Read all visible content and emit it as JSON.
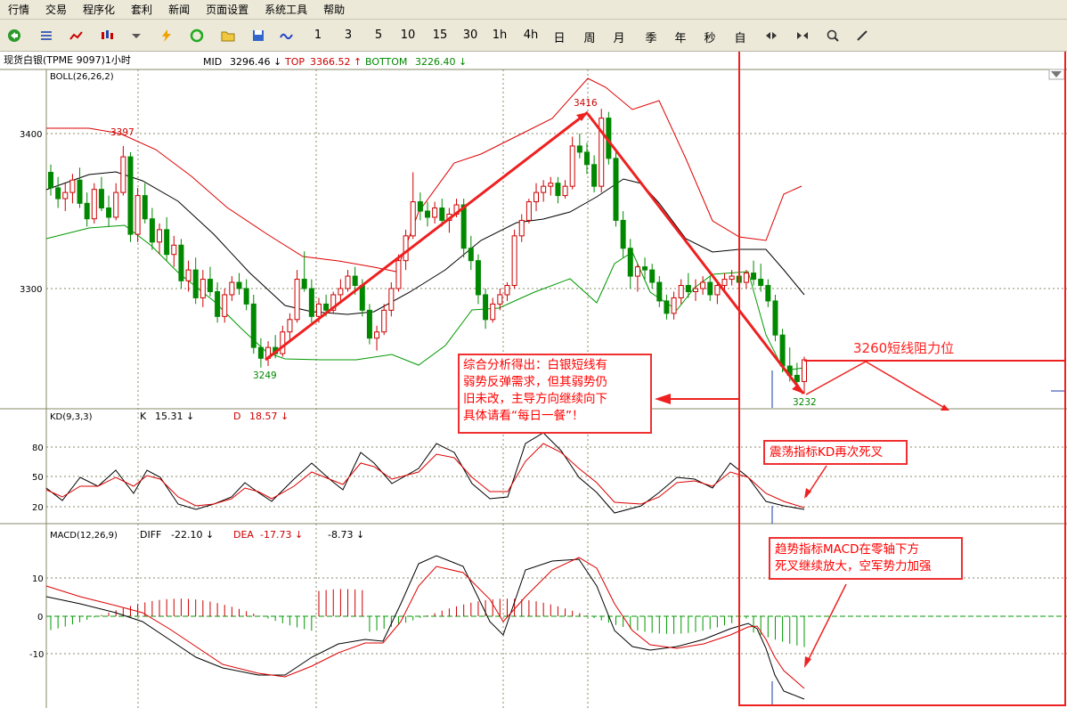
{
  "menu": [
    "行情",
    "交易",
    "程序化",
    "套利",
    "新闻",
    "页面设置",
    "系统工具",
    "帮助"
  ],
  "toolbar": {
    "icons": [
      "back-arrow-icon",
      "list-icon",
      "line-chart-icon",
      "candlestick-icon",
      "dropdown-arrow-icon",
      "lightning-icon",
      "refresh-icon",
      "open-folder-icon",
      "save-icon",
      "wave-icon"
    ],
    "periods": [
      "1",
      "3",
      "5",
      "10",
      "15",
      "30",
      "1h",
      "4h",
      "日",
      "周",
      "月",
      "季",
      "年",
      "秒",
      "自"
    ],
    "tool_icons": [
      "zoom-in-icon",
      "zoom-out-icon",
      "search-icon",
      "pen-icon"
    ]
  },
  "header": {
    "instrument": "现货白银(TPME 9097)1小时",
    "mid_label": "MID",
    "mid_value": "3296.46 ↓",
    "top_label": "TOP",
    "top_value": "3366.52 ↑",
    "bottom_label": "BOTTOM",
    "bottom_value": "3226.40 ↓"
  },
  "panels": {
    "boll": {
      "title": "BOLL(26,26,2)",
      "yticks": [
        "3400",
        "3300"
      ]
    },
    "kd": {
      "title": "KD(9,3,3)",
      "k_label": "K",
      "k_value": "15.31 ↓",
      "d_label": "D",
      "d_value": "18.57 ↓",
      "yticks": [
        "80",
        "50",
        "20"
      ]
    },
    "macd": {
      "title": "MACD(12,26,9)",
      "diff_label": "DIFF",
      "diff_value": "-22.10 ↓",
      "dea_label": "DEA",
      "dea_value": "-17.73 ↓",
      "macd_value": "-8.73 ↓",
      "yticks": [
        "10",
        "0",
        "-10"
      ]
    }
  },
  "price_labels": {
    "high1": "3397",
    "high2": "3416",
    "low1": "3249",
    "low2": "3232"
  },
  "annotations": {
    "resistance": "3260短线阻力位",
    "summary": [
      "综合分析得出：白银短线有",
      "弱势反弹需求，但其弱势仍",
      "旧未改，主导方向继续向下",
      "具体请看“每日一餐”！"
    ],
    "kd_note": "震荡指标KD再次死叉",
    "macd_note": [
      "趋势指标MACD在零轴下方",
      "死叉继续放大，空军势力加强"
    ]
  },
  "colors": {
    "up": "#cc0000",
    "down": "#008800",
    "boll_upper": "#dd0000",
    "boll_mid": "#000000",
    "boll_lower": "#009900",
    "annotation": "#f03030",
    "toolbar_bg": "#ece9d8"
  },
  "chart_data": {
    "type": "candlestick",
    "bars": [
      [
        3375,
        3380,
        3360,
        3365
      ],
      [
        3365,
        3372,
        3352,
        3358
      ],
      [
        3358,
        3368,
        3350,
        3362
      ],
      [
        3362,
        3374,
        3355,
        3370
      ],
      [
        3370,
        3378,
        3352,
        3355
      ],
      [
        3355,
        3362,
        3340,
        3345
      ],
      [
        3345,
        3368,
        3342,
        3364
      ],
      [
        3364,
        3372,
        3350,
        3352
      ],
      [
        3352,
        3360,
        3340,
        3346
      ],
      [
        3346,
        3368,
        3344,
        3362
      ],
      [
        3362,
        3392,
        3360,
        3385
      ],
      [
        3385,
        3388,
        3330,
        3335
      ],
      [
        3335,
        3365,
        3330,
        3360
      ],
      [
        3360,
        3368,
        3342,
        3345
      ],
      [
        3345,
        3352,
        3325,
        3330
      ],
      [
        3330,
        3342,
        3322,
        3338
      ],
      [
        3338,
        3346,
        3318,
        3322
      ],
      [
        3322,
        3334,
        3314,
        3328
      ],
      [
        3328,
        3332,
        3300,
        3305
      ],
      [
        3305,
        3318,
        3298,
        3312
      ],
      [
        3312,
        3320,
        3290,
        3294
      ],
      [
        3294,
        3312,
        3288,
        3306
      ],
      [
        3306,
        3314,
        3295,
        3298
      ],
      [
        3298,
        3304,
        3278,
        3282
      ],
      [
        3282,
        3300,
        3278,
        3296
      ],
      [
        3296,
        3308,
        3292,
        3304
      ],
      [
        3304,
        3310,
        3296,
        3300
      ],
      [
        3300,
        3306,
        3286,
        3290
      ],
      [
        3290,
        3296,
        3258,
        3262
      ],
      [
        3262,
        3268,
        3249,
        3255
      ],
      [
        3255,
        3266,
        3250,
        3262
      ],
      [
        3262,
        3270,
        3255,
        3258
      ],
      [
        3258,
        3276,
        3256,
        3272
      ],
      [
        3272,
        3284,
        3266,
        3280
      ],
      [
        3280,
        3312,
        3278,
        3306
      ],
      [
        3306,
        3324,
        3298,
        3300
      ],
      [
        3300,
        3306,
        3278,
        3282
      ],
      [
        3282,
        3294,
        3278,
        3290
      ],
      [
        3290,
        3296,
        3282,
        3286
      ],
      [
        3286,
        3298,
        3284,
        3296
      ],
      [
        3296,
        3306,
        3292,
        3300
      ],
      [
        3300,
        3312,
        3298,
        3308
      ],
      [
        3308,
        3314,
        3296,
        3302
      ],
      [
        3302,
        3306,
        3282,
        3286
      ],
      [
        3286,
        3290,
        3264,
        3268
      ],
      [
        3268,
        3276,
        3260,
        3272
      ],
      [
        3272,
        3290,
        3270,
        3286
      ],
      [
        3286,
        3304,
        3282,
        3300
      ],
      [
        3300,
        3322,
        3298,
        3318
      ],
      [
        3318,
        3338,
        3312,
        3334
      ],
      [
        3334,
        3375,
        3332,
        3356
      ],
      [
        3356,
        3362,
        3344,
        3350
      ],
      [
        3350,
        3356,
        3340,
        3346
      ],
      [
        3346,
        3356,
        3342,
        3352
      ],
      [
        3352,
        3358,
        3340,
        3344
      ],
      [
        3344,
        3352,
        3336,
        3348
      ],
      [
        3348,
        3358,
        3346,
        3354
      ],
      [
        3354,
        3358,
        3320,
        3326
      ],
      [
        3326,
        3334,
        3312,
        3318
      ],
      [
        3318,
        3322,
        3290,
        3296
      ],
      [
        3296,
        3300,
        3274,
        3280
      ],
      [
        3280,
        3294,
        3278,
        3290
      ],
      [
        3290,
        3300,
        3286,
        3296
      ],
      [
        3296,
        3304,
        3292,
        3302
      ],
      [
        3302,
        3338,
        3300,
        3334
      ],
      [
        3334,
        3348,
        3330,
        3344
      ],
      [
        3344,
        3358,
        3342,
        3356
      ],
      [
        3356,
        3368,
        3350,
        3362
      ],
      [
        3362,
        3370,
        3356,
        3366
      ],
      [
        3366,
        3372,
        3360,
        3368
      ],
      [
        3368,
        3372,
        3355,
        3360
      ],
      [
        3360,
        3370,
        3358,
        3366
      ],
      [
        3366,
        3398,
        3364,
        3392
      ],
      [
        3392,
        3400,
        3384,
        3388
      ],
      [
        3388,
        3394,
        3374,
        3380
      ],
      [
        3380,
        3386,
        3362,
        3366
      ],
      [
        3366,
        3416,
        3362,
        3410
      ],
      [
        3410,
        3414,
        3380,
        3384
      ],
      [
        3384,
        3390,
        3340,
        3344
      ],
      [
        3344,
        3350,
        3320,
        3326
      ],
      [
        3326,
        3332,
        3300,
        3308
      ],
      [
        3308,
        3316,
        3298,
        3314
      ],
      [
        3314,
        3320,
        3306,
        3312
      ],
      [
        3312,
        3316,
        3300,
        3304
      ],
      [
        3304,
        3308,
        3288,
        3292
      ],
      [
        3292,
        3296,
        3280,
        3284
      ],
      [
        3284,
        3298,
        3280,
        3294
      ],
      [
        3294,
        3306,
        3290,
        3302
      ],
      [
        3302,
        3310,
        3294,
        3298
      ],
      [
        3298,
        3306,
        3292,
        3300
      ],
      [
        3300,
        3308,
        3296,
        3304
      ],
      [
        3304,
        3308,
        3292,
        3296
      ],
      [
        3296,
        3304,
        3290,
        3302
      ],
      [
        3302,
        3310,
        3298,
        3306
      ],
      [
        3306,
        3312,
        3302,
        3308
      ],
      [
        3308,
        3314,
        3300,
        3304
      ],
      [
        3304,
        3312,
        3300,
        3310
      ],
      [
        3310,
        3318,
        3302,
        3306
      ],
      [
        3306,
        3316,
        3298,
        3302
      ],
      [
        3302,
        3306,
        3288,
        3292
      ],
      [
        3292,
        3296,
        3266,
        3270
      ],
      [
        3270,
        3274,
        3246,
        3250
      ],
      [
        3250,
        3262,
        3240,
        3244
      ],
      [
        3244,
        3252,
        3234,
        3240
      ],
      [
        3240,
        3256,
        3232,
        3254
      ]
    ],
    "y_range": [
      3225,
      3440
    ]
  }
}
